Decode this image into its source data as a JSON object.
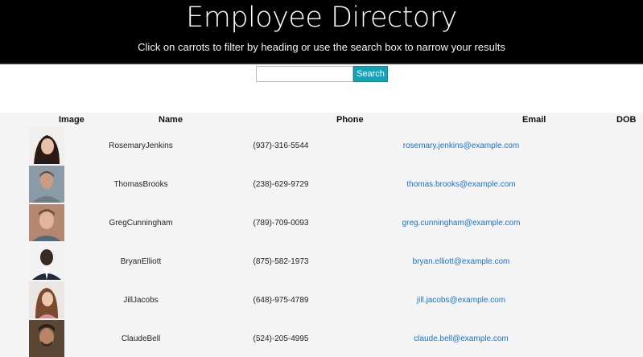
{
  "header": {
    "title": "Employee Directory",
    "subtitle": "Click on carrots to filter by heading or use the search box to narrow your results"
  },
  "search": {
    "value": "",
    "placeholder": "",
    "button_label": "Search",
    "accent_color": "#17a2b8"
  },
  "table": {
    "columns": [
      "Image",
      "Name",
      "Phone",
      "Email",
      "DOB"
    ],
    "rows": [
      {
        "name": "RosemaryJenkins",
        "phone": "(937)-316-5544",
        "email": "rosemary.jenkins@example.com",
        "dob": "",
        "avatar": "photo-icon"
      },
      {
        "name": "ThomasBrooks",
        "phone": "(238)-629-9729",
        "email": "thomas.brooks@example.com",
        "dob": "",
        "avatar": "photo-icon"
      },
      {
        "name": "GregCunningham",
        "phone": "(789)-709-0093",
        "email": "greg.cunningham@example.com",
        "dob": "",
        "avatar": "photo-icon"
      },
      {
        "name": "BryanElliott",
        "phone": "(875)-582-1973",
        "email": "bryan.elliott@example.com",
        "dob": "",
        "avatar": "photo-icon"
      },
      {
        "name": "JillJacobs",
        "phone": "(648)-975-4789",
        "email": "jill.jacobs@example.com",
        "dob": "",
        "avatar": "photo-icon"
      },
      {
        "name": "ClaudeBell",
        "phone": "(524)-205-4995",
        "email": "claude.bell@example.com",
        "dob": "",
        "avatar": "photo-icon"
      }
    ]
  },
  "colors": {
    "header_bg": "#000000",
    "table_bg": "#f4f4f4",
    "link": "#1a73c9"
  }
}
